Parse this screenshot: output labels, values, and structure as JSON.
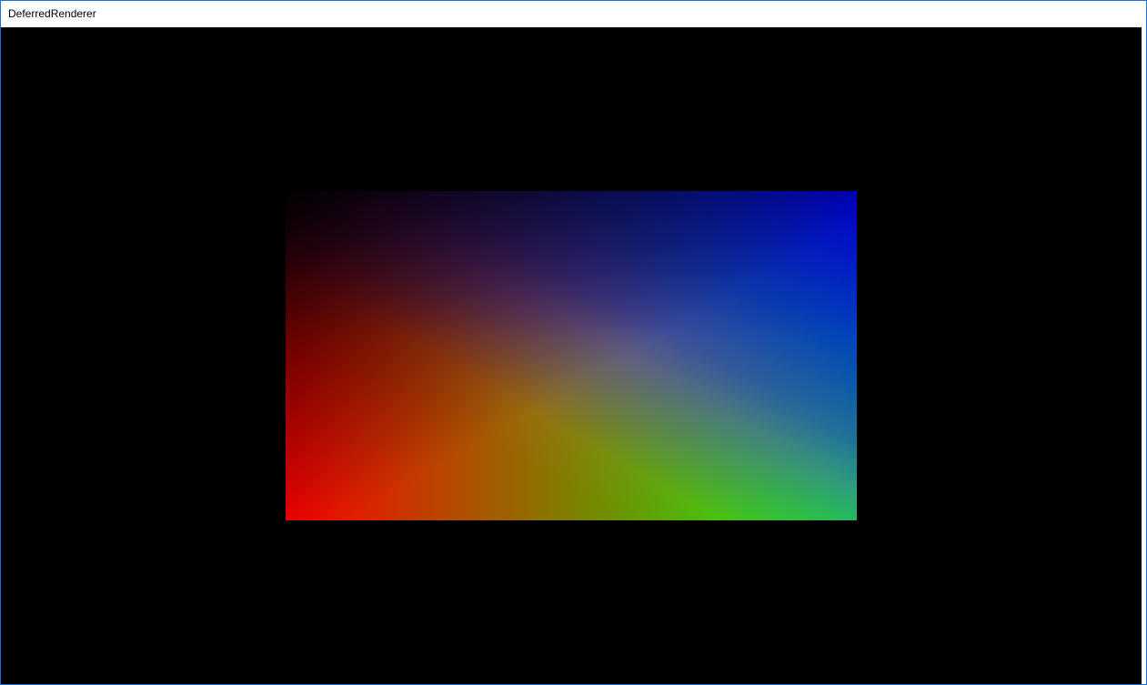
{
  "window": {
    "title": "DeferredRenderer"
  },
  "render": {
    "clear_color": "#000000",
    "corner_colors": {
      "top_left": "#000000",
      "top_right": "#0000ff",
      "bottom_left": "#ff0000",
      "bottom_right": "#00ff00"
    }
  }
}
